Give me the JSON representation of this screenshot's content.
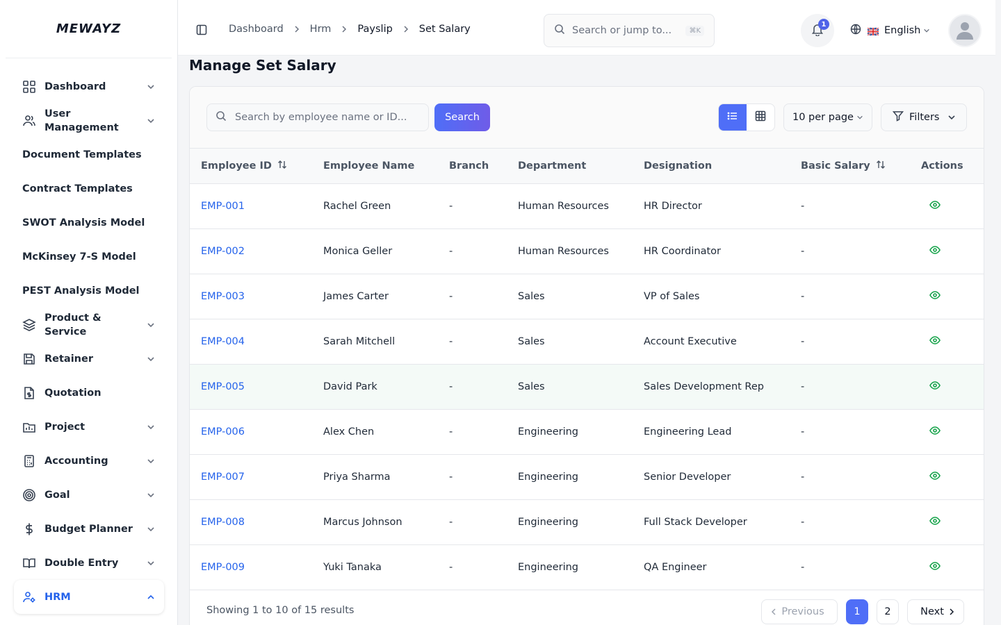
{
  "brand": {
    "logo": "MEWAYZ"
  },
  "sidebar": {
    "items": [
      {
        "label": "Dashboard",
        "icon": "grid-icon"
      },
      {
        "label": "User Management",
        "icon": "users-icon"
      },
      {
        "label": "Document Templates"
      },
      {
        "label": "Contract Templates"
      },
      {
        "label": "SWOT Analysis Model"
      },
      {
        "label": "McKinsey 7-S Model"
      },
      {
        "label": "PEST Analysis Model"
      },
      {
        "label": "Product & Service",
        "icon": "layers-icon"
      },
      {
        "label": "Retainer",
        "icon": "save-icon"
      },
      {
        "label": "Quotation",
        "icon": "file-dollar-icon"
      },
      {
        "label": "Project",
        "icon": "folder-icon"
      },
      {
        "label": "Accounting",
        "icon": "calculator-icon"
      },
      {
        "label": "Goal",
        "icon": "target-icon"
      },
      {
        "label": "Budget Planner",
        "icon": "dollar-icon"
      },
      {
        "label": "Double Entry",
        "icon": "book-icon"
      },
      {
        "label": "HRM",
        "icon": "user-cog-icon"
      }
    ]
  },
  "header": {
    "breadcrumb": [
      "Dashboard",
      "Hrm",
      "Payslip",
      "Set Salary"
    ],
    "search_placeholder": "Search or jump to...",
    "search_shortcut": "⌘K",
    "notification_count": "1",
    "language": "English"
  },
  "page": {
    "title": "Manage Set Salary"
  },
  "toolbar": {
    "search_placeholder": "Search by employee name or ID...",
    "search_button": "Search",
    "per_page": "10 per page",
    "filters": "Filters"
  },
  "table": {
    "columns": [
      "Employee ID",
      "Employee Name",
      "Branch",
      "Department",
      "Designation",
      "Basic Salary",
      "Actions"
    ],
    "rows": [
      {
        "id": "EMP-001",
        "name": "Rachel Green",
        "branch": "-",
        "department": "Human Resources",
        "designation": "HR Director",
        "salary": "-"
      },
      {
        "id": "EMP-002",
        "name": "Monica Geller",
        "branch": "-",
        "department": "Human Resources",
        "designation": "HR Coordinator",
        "salary": "-"
      },
      {
        "id": "EMP-003",
        "name": "James Carter",
        "branch": "-",
        "department": "Sales",
        "designation": "VP of Sales",
        "salary": "-"
      },
      {
        "id": "EMP-004",
        "name": "Sarah Mitchell",
        "branch": "-",
        "department": "Sales",
        "designation": "Account Executive",
        "salary": "-"
      },
      {
        "id": "EMP-005",
        "name": "David Park",
        "branch": "-",
        "department": "Sales",
        "designation": "Sales Development Rep",
        "salary": "-"
      },
      {
        "id": "EMP-006",
        "name": "Alex Chen",
        "branch": "-",
        "department": "Engineering",
        "designation": "Engineering Lead",
        "salary": "-"
      },
      {
        "id": "EMP-007",
        "name": "Priya Sharma",
        "branch": "-",
        "department": "Engineering",
        "designation": "Senior Developer",
        "salary": "-"
      },
      {
        "id": "EMP-008",
        "name": "Marcus Johnson",
        "branch": "-",
        "department": "Engineering",
        "designation": "Full Stack Developer",
        "salary": "-"
      },
      {
        "id": "EMP-009",
        "name": "Yuki Tanaka",
        "branch": "-",
        "department": "Engineering",
        "designation": "QA Engineer",
        "salary": "-"
      }
    ]
  },
  "pagination": {
    "summary": "Showing 1 to 10 of 15 results",
    "previous": "Previous",
    "pages": [
      "1",
      "2"
    ],
    "next": "Next"
  },
  "colors": {
    "accent": "#4f6ef7",
    "link": "#2563eb",
    "view_icon": "#16a34a"
  }
}
